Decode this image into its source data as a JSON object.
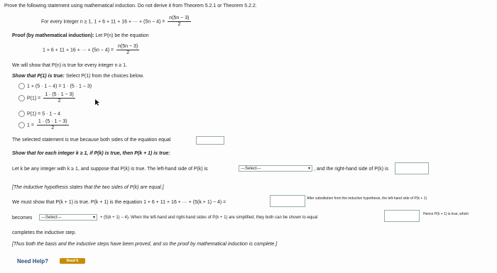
{
  "prompt": "Prove the following statement using mathematical induction. Do not derive it from Theorem 5.2.1 or Theorem 5.2.2.",
  "statement": {
    "lead": "For every integer n ≥ 1, 1 + 6 + 11 + 16 + ··· + (5n − 4) =",
    "frac_num": "n(5n − 3)",
    "frac_den": "2"
  },
  "proof_header": {
    "bold": "Proof (by mathematical induction):",
    "rest": "Let P(n) be the equation"
  },
  "equation": {
    "lead": "1 + 6 + 11 + 16 + ··· + (5n − 4) =",
    "frac_num": "n(5n − 3)",
    "frac_den": "2"
  },
  "will_show": "We will show that P(n) is true for every integer n ≥ 1.",
  "show_p1": {
    "bold": "Show that P(1) is true:",
    "rest": "Select P(1) from the choices below."
  },
  "choices": [
    {
      "text": "1 + (5 · 1 − 4) = 1 · (5 · 1 − 3)"
    },
    {
      "lead": "P(1) =",
      "frac_num": "1 · (5 · 1 − 3)",
      "frac_den": "2"
    },
    {
      "text": "P(1) = 5 · 1 − 4"
    },
    {
      "lead": "1 =",
      "frac_num": "1 · (5 · 1 − 3)",
      "frac_den": "2"
    }
  ],
  "selected_statement": "The selected statement is true because both sides of the equation equal",
  "show_pk": "Show that for each integer k ≥ 1, if P(k) is true, then P(k + 1) is true:",
  "let_k": "Let k be any integer with k ≥ 1, and suppose that P(k) is true. The left-hand side of P(k) is",
  "select_placeholder": "---Select---",
  "right_hand": ", and the right-hand side of P(k) is",
  "hypothesis": "[The inductive hypothesis states that the two sides of P(k) are equal.]",
  "must_show": "We must show that P(k + 1) is true. P(k + 1) is the equation 1 + 6 + 11 + 16 + ··· + (5(k + 1) − 4) =",
  "after_sub": "After substitution from the inductive hypothesis, the left-hand side of P(k + 1)",
  "becomes": "becomes",
  "plus_term": "+ (5(k + 1) − 4). When the left-hand and right-hand sides of P(k + 1) are simplified, they both can be shown to equal",
  "hence": "Hence P(k + 1) is true, which",
  "completes": "completes the inductive step.",
  "thus_both": "[Thus both the basis and the inductive steps have been proved, and so the proof by mathematical induction is complete.]",
  "need_help": "Need Help?",
  "read_it": "Read It",
  "colors": {
    "help": "#c98c00",
    "need_help_text": "#2b4f7a"
  }
}
